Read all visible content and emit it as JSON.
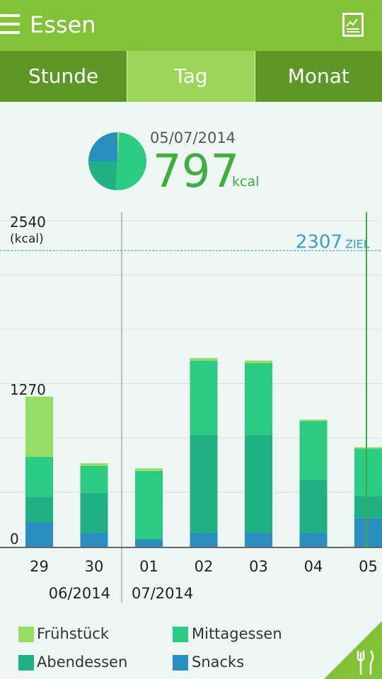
{
  "app": {
    "title": "Essen"
  },
  "tabs": [
    {
      "label": "Stunde",
      "active": false
    },
    {
      "label": "Tag",
      "active": true
    },
    {
      "label": "Monat",
      "active": false
    }
  ],
  "summary": {
    "date": "05/07/2014",
    "value": "797",
    "unit": "kcal",
    "pie": [
      {
        "name": "Frühstück",
        "value": 1
      },
      {
        "name": "Mittagessen",
        "value": 50
      },
      {
        "name": "Abendessen",
        "value": 24
      },
      {
        "name": "Snacks",
        "value": 25
      }
    ]
  },
  "chart_data": {
    "type": "bar",
    "stacked": true,
    "ylim": [
      0,
      2540
    ],
    "y_top_label": "2540",
    "y_top_unit": "(kcal)",
    "y_mid_label": "1270",
    "y_zero_label": "0",
    "goal": {
      "value": 2307,
      "value_label": "2307",
      "label": "ZIEL"
    },
    "categories": [
      "29",
      "30",
      "01",
      "02",
      "03",
      "04",
      "05"
    ],
    "month_labels": [
      "06/2014",
      "07/2014"
    ],
    "series": [
      {
        "name": "Snacks",
        "values": [
          190,
          110,
          60,
          110,
          110,
          110,
          225
        ]
      },
      {
        "name": "Abendessen",
        "values": [
          200,
          310,
          0,
          760,
          760,
          410,
          170
        ]
      },
      {
        "name": "Mittagessen",
        "values": [
          310,
          210,
          530,
          580,
          560,
          460,
          370
        ]
      },
      {
        "name": "Frühstück",
        "values": [
          470,
          20,
          20,
          20,
          20,
          10,
          10
        ]
      }
    ],
    "grid": true
  },
  "legend": [
    {
      "label": "Frühstück",
      "color": "#96dd66"
    },
    {
      "label": "Mittagessen",
      "color": "#2ccb84"
    },
    {
      "label": "Abendessen",
      "color": "#20b182"
    },
    {
      "label": "Snacks",
      "color": "#2a8fbe"
    }
  ],
  "colors": {
    "appbar": "#82c236",
    "tabs": "#5d9726",
    "accent": "#3fae3d",
    "goal": "#3b9fc2"
  },
  "icons": {
    "menu": "hamburger-menu-icon",
    "report": "chart-report-icon",
    "food": "fork-knife-icon"
  }
}
